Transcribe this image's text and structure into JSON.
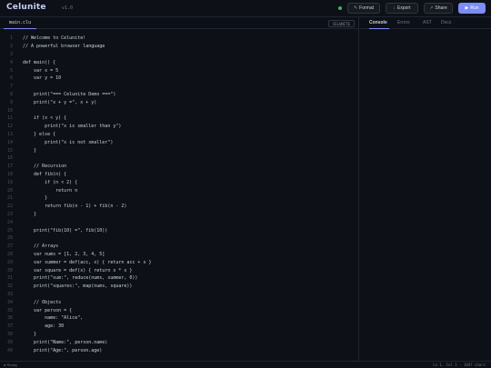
{
  "header": {
    "logo": "Celunite",
    "version": "v1.0",
    "buttons": {
      "format": {
        "icon": "✎",
        "label": "Format"
      },
      "export": {
        "icon": "↓",
        "label": "Export"
      },
      "share": {
        "icon": "↗",
        "label": "Share"
      },
      "run": {
        "icon": "▶",
        "label": "Run"
      }
    }
  },
  "editor": {
    "file_tab": "main.clu",
    "language_badge": "CELUNITE",
    "lines": [
      {
        "n": "1",
        "t": "// Welcome to Celunite!"
      },
      {
        "n": "2",
        "t": "// A powerful browser language"
      },
      {
        "n": "3",
        "t": ""
      },
      {
        "n": "4",
        "t": "def main() {"
      },
      {
        "n": "5",
        "t": "    var x = 5"
      },
      {
        "n": "6",
        "t": "    var y = 10"
      },
      {
        "n": "7",
        "t": ""
      },
      {
        "n": "8",
        "t": "    print(\"=== Celunite Demo ===\")"
      },
      {
        "n": "9",
        "t": "    print(\"x + y =\", x + y)"
      },
      {
        "n": "10",
        "t": ""
      },
      {
        "n": "11",
        "t": "    if (x < y) {"
      },
      {
        "n": "12",
        "t": "        print(\"x is smaller than y\")"
      },
      {
        "n": "13",
        "t": "    } else {"
      },
      {
        "n": "14",
        "t": "        print(\"x is not smaller\")"
      },
      {
        "n": "15",
        "t": "    }"
      },
      {
        "n": "16",
        "t": ""
      },
      {
        "n": "17",
        "t": "    // Recursion"
      },
      {
        "n": "18",
        "t": "    def fib(n) {"
      },
      {
        "n": "19",
        "t": "        if (n < 2) {"
      },
      {
        "n": "20",
        "t": "            return n"
      },
      {
        "n": "21",
        "t": "        }"
      },
      {
        "n": "22",
        "t": "        return fib(n - 1) + fib(n - 2)"
      },
      {
        "n": "23",
        "t": "    }"
      },
      {
        "n": "24",
        "t": ""
      },
      {
        "n": "25",
        "t": "    print(\"fib(10) =\", fib(10))"
      },
      {
        "n": "26",
        "t": ""
      },
      {
        "n": "27",
        "t": "    // Arrays"
      },
      {
        "n": "28",
        "t": "    var nums = [1, 2, 3, 4, 5]"
      },
      {
        "n": "29",
        "t": "    var summer = def(acc, x) { return acc + x }"
      },
      {
        "n": "30",
        "t": "    var square = def(x) { return x * x }"
      },
      {
        "n": "31",
        "t": "    print(\"sum:\", reduce(nums, summer, 0))"
      },
      {
        "n": "32",
        "t": "    print(\"squares:\", map(nums, square))"
      },
      {
        "n": "33",
        "t": ""
      },
      {
        "n": "34",
        "t": "    // Objects"
      },
      {
        "n": "35",
        "t": "    var person = {"
      },
      {
        "n": "36",
        "t": "        name: \"Alice\","
      },
      {
        "n": "37",
        "t": "        age: 30"
      },
      {
        "n": "38",
        "t": "    }"
      },
      {
        "n": "39",
        "t": "    print(\"Name:\", person.name)"
      },
      {
        "n": "40",
        "t": "    print(\"Age:\", person.age)"
      }
    ]
  },
  "panel": {
    "tabs": [
      "Console",
      "Errors",
      "AST",
      "Docs"
    ],
    "active_tab": "Console"
  },
  "statusbar": {
    "left": "● Ready",
    "right": "Ln 1, Col 1 · 1047 chars"
  },
  "colors": {
    "accent": "#7c8cf8",
    "status_ok": "#3fb950",
    "background": "#0d1117"
  }
}
